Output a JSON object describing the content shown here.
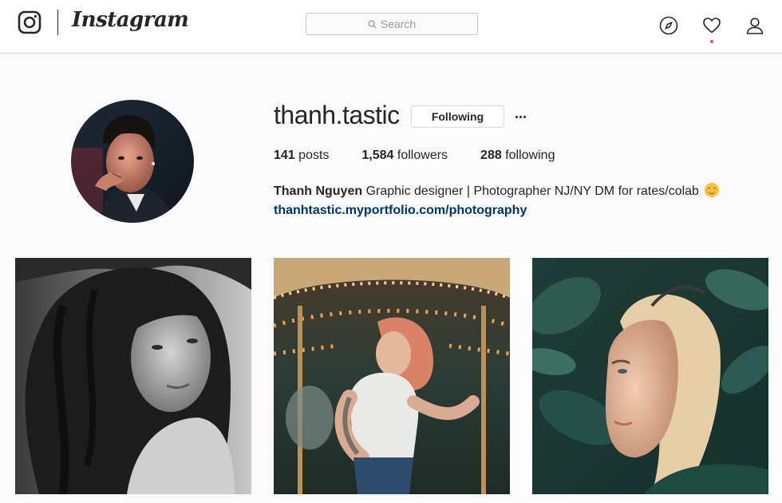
{
  "header": {
    "brand_name": "Instagram",
    "logo_icon": "instagram-camera-icon",
    "search_placeholder": "Search",
    "nav_icons": [
      "compass-icon",
      "heart-icon",
      "person-icon"
    ],
    "notification_dot_color": "#ed4956"
  },
  "profile": {
    "username": "thanh.tastic",
    "follow_label": "Following",
    "more_icon": "more-options-icon",
    "stats": {
      "posts_count": "141",
      "posts_label": "posts",
      "followers_count": "1,584",
      "followers_label": "followers",
      "following_count": "288",
      "following_label": "following"
    },
    "bio": {
      "full_name": "Thanh Nguyen",
      "text": "Graphic designer | Photographer NJ/NY DM for rates/colab",
      "emoji": "smiling-face-icon",
      "link": "thanhtastic.myportfolio.com/photography"
    }
  },
  "colors": {
    "link": "#003569",
    "border": "#dbdbdb",
    "background": "#fafafa"
  },
  "posts": [
    {
      "subject": "black-and-white portrait of woman with curly hair"
    },
    {
      "subject": "woman with tattoos at a carousel"
    },
    {
      "subject": "blonde woman in profile among green leaves"
    }
  ]
}
